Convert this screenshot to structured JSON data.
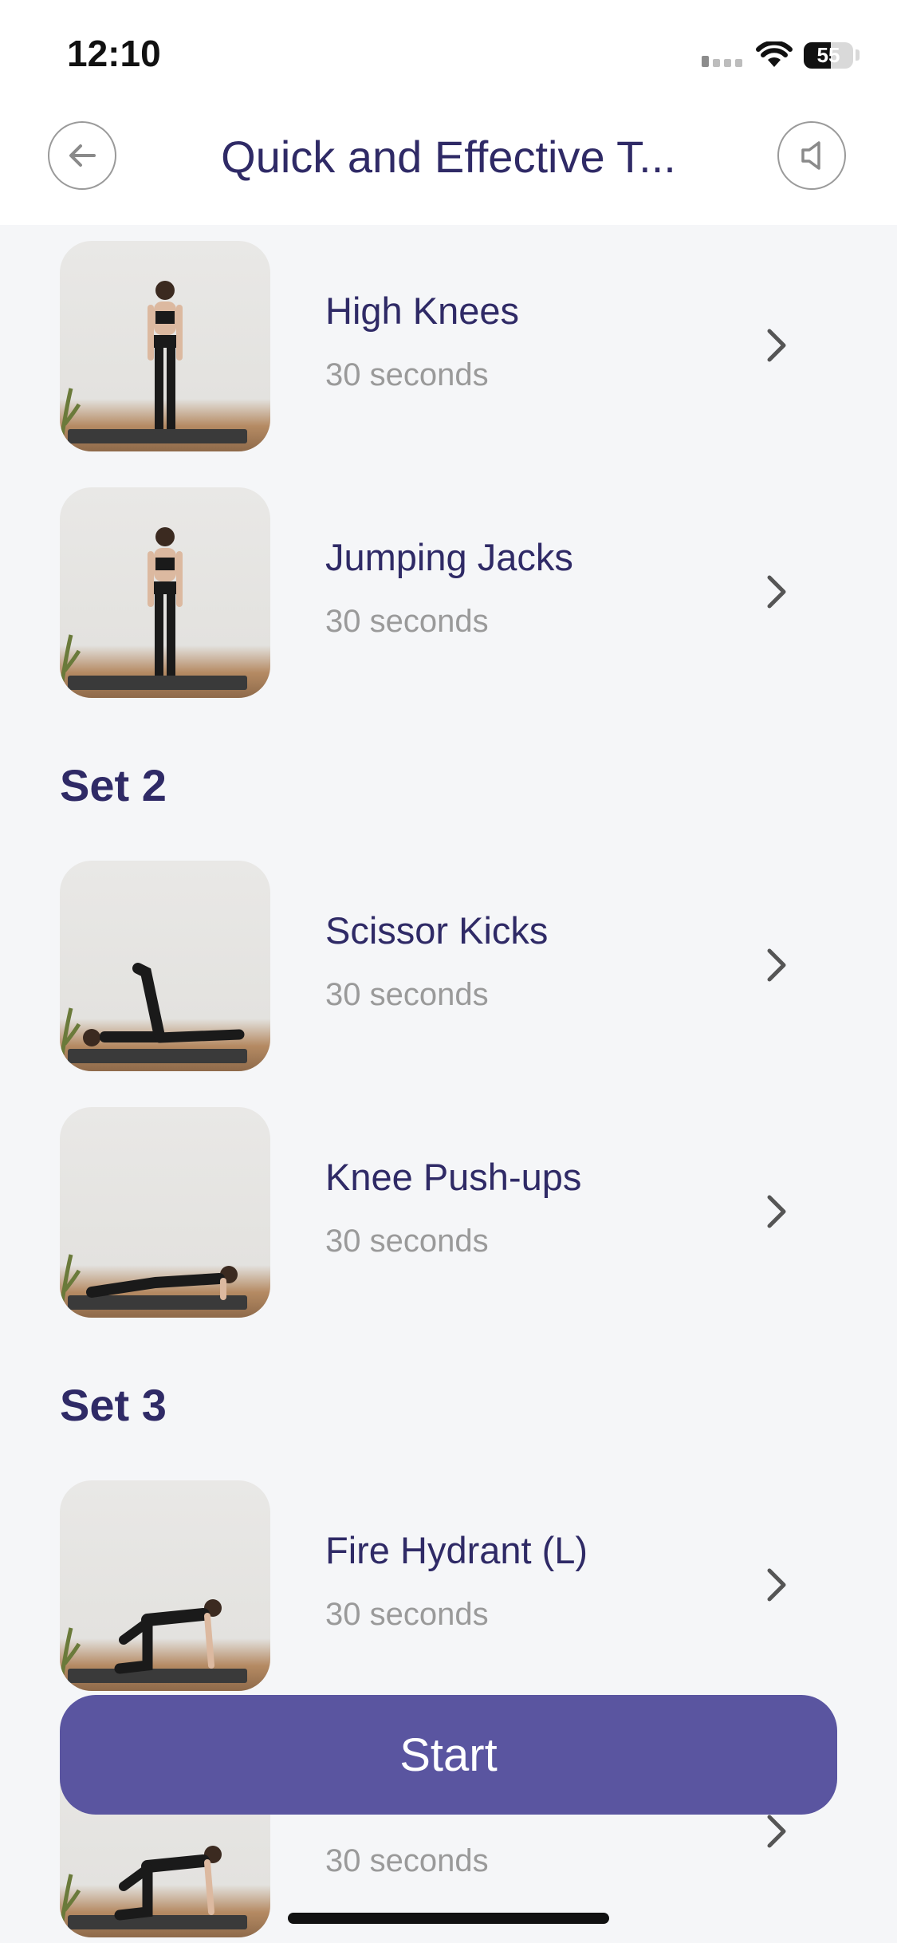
{
  "status_bar": {
    "time": "12:10",
    "battery": "55"
  },
  "nav": {
    "title": "Quick and Effective T...",
    "back_icon": "arrow-left-icon",
    "sound_icon": "speaker-icon"
  },
  "exercises": [
    {
      "name": "High Knees",
      "duration": "30 seconds",
      "pose": "standing"
    },
    {
      "name": "Jumping Jacks",
      "duration": "30 seconds",
      "pose": "standing"
    },
    {
      "name": "Scissor Kicks",
      "duration": "30 seconds",
      "pose": "lying"
    },
    {
      "name": "Knee Push-ups",
      "duration": "30 seconds",
      "pose": "pushup"
    },
    {
      "name": "Fire Hydrant (L)",
      "duration": "30 seconds",
      "pose": "quadruped"
    },
    {
      "name": "",
      "duration": "30 seconds",
      "pose": "quadruped"
    }
  ],
  "sets": {
    "set2": "Set 2",
    "set3": "Set 3"
  },
  "start_button": "Start",
  "colors": {
    "accent": "#5a55a0",
    "title": "#2f2a66",
    "muted": "#9a9a9a",
    "background": "#f5f6f8"
  }
}
